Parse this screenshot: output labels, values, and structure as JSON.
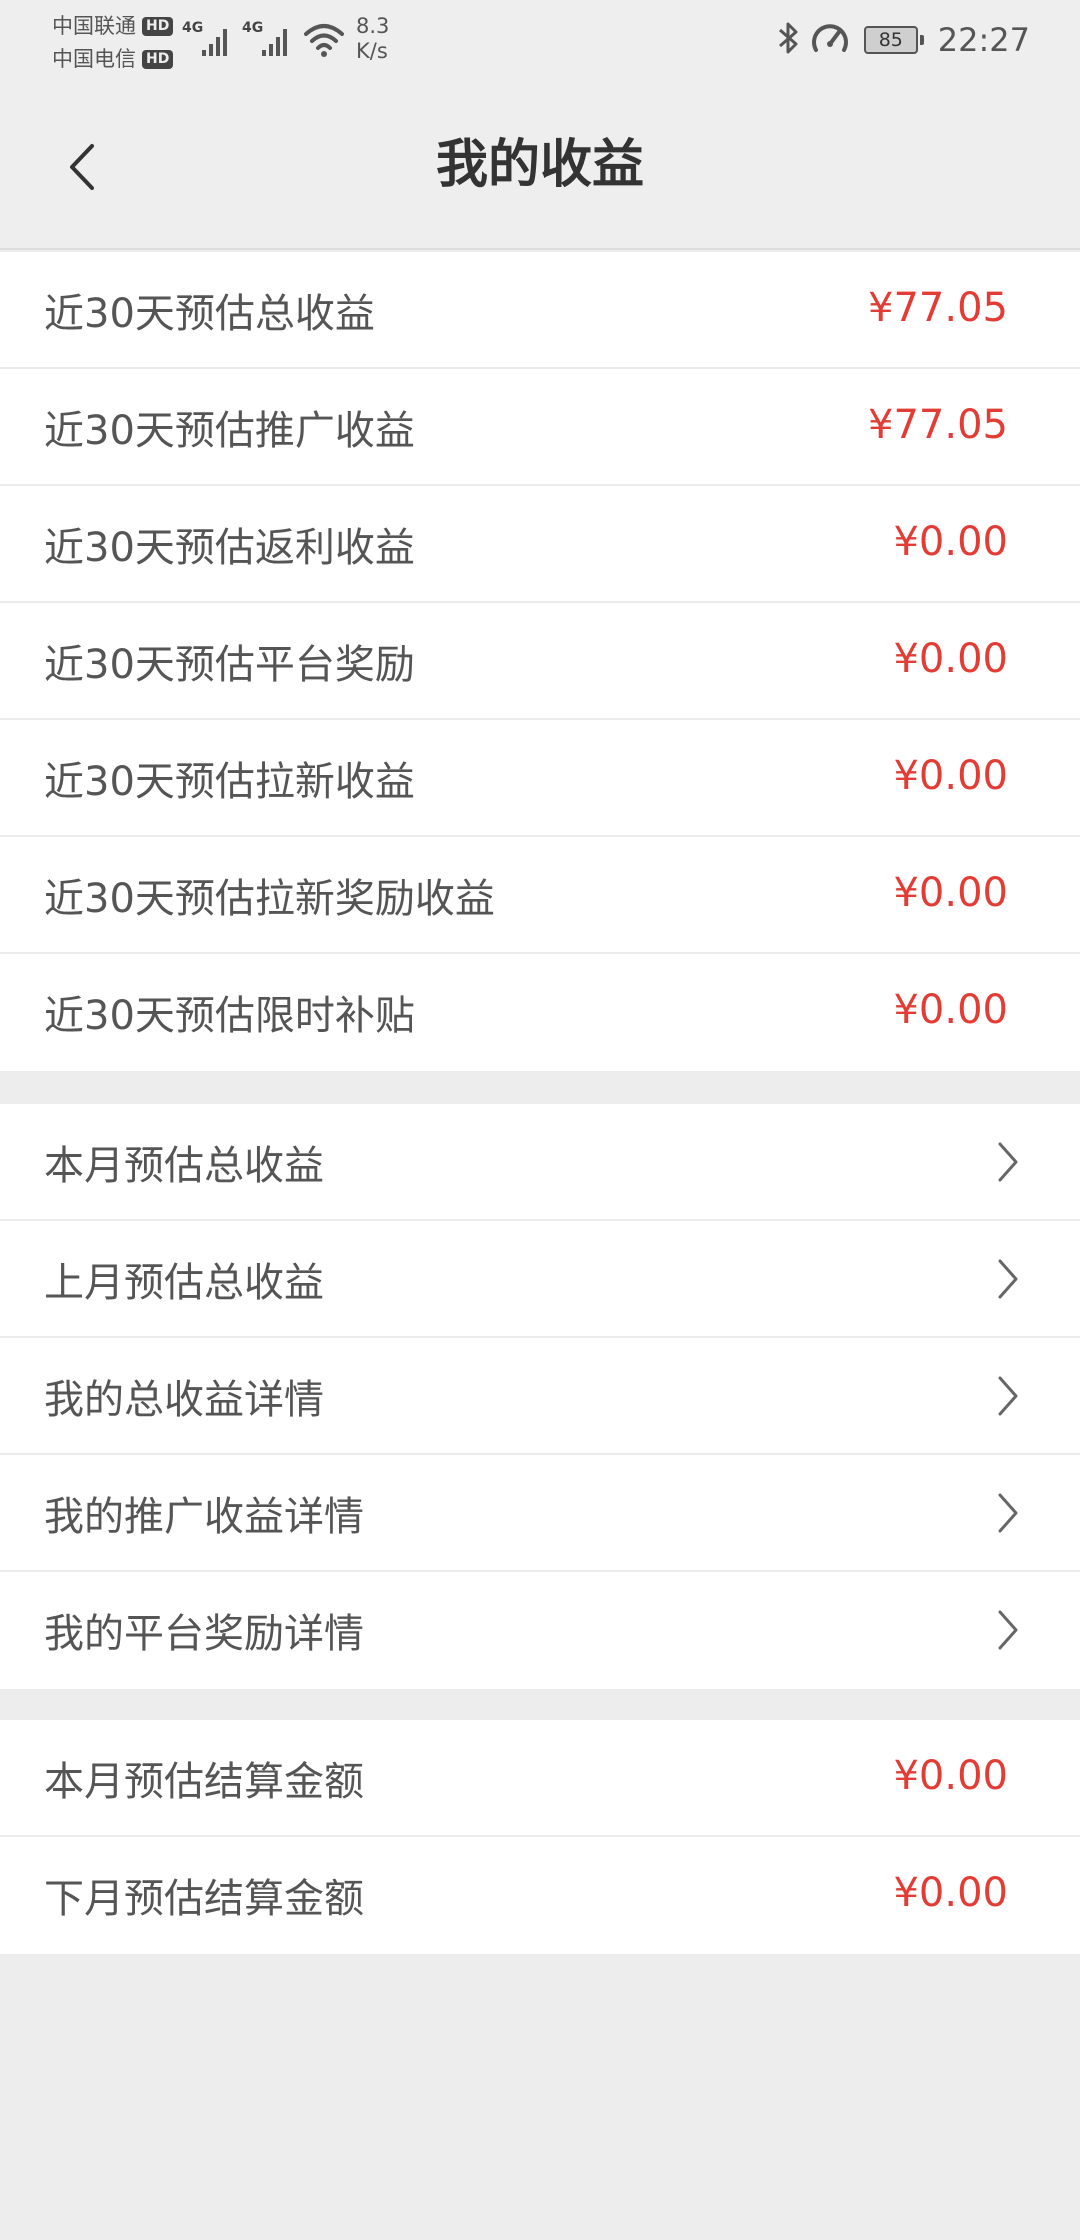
{
  "status_bar": {
    "carrier1": "中国联通",
    "carrier2": "中国电信",
    "hd_badge": "HD",
    "network_label": "4G",
    "speed_value": "8.3",
    "speed_unit": "K/s",
    "battery": "85",
    "time": "22:27"
  },
  "header": {
    "title": "我的收益"
  },
  "section1": {
    "rows": [
      {
        "label": "近30天预估总收益",
        "value": "¥77.05"
      },
      {
        "label": "近30天预估推广收益",
        "value": "¥77.05"
      },
      {
        "label": "近30天预估返利收益",
        "value": "¥0.00"
      },
      {
        "label": "近30天预估平台奖励",
        "value": "¥0.00"
      },
      {
        "label": "近30天预估拉新收益",
        "value": "¥0.00"
      },
      {
        "label": "近30天预估拉新奖励收益",
        "value": "¥0.00"
      },
      {
        "label": "近30天预估限时补贴",
        "value": "¥0.00"
      }
    ]
  },
  "section2": {
    "rows": [
      {
        "label": "本月预估总收益"
      },
      {
        "label": "上月预估总收益"
      },
      {
        "label": "我的总收益详情"
      },
      {
        "label": "我的推广收益详情"
      },
      {
        "label": "我的平台奖励详情"
      }
    ]
  },
  "section3": {
    "rows": [
      {
        "label": "本月预估结算金额",
        "value": "¥0.00"
      },
      {
        "label": "下月预估结算金额",
        "value": "¥0.00"
      }
    ]
  },
  "colors": {
    "accent_value": "#e23c35",
    "background": "#ededed"
  }
}
